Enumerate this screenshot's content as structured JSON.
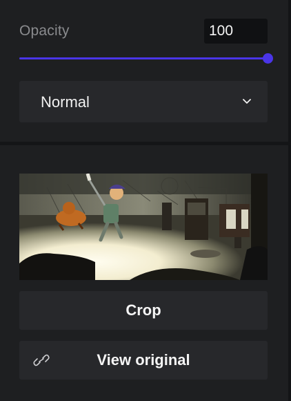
{
  "layer_settings": {
    "opacity_label": "Opacity",
    "opacity_value": "100",
    "opacity_percent": 100,
    "accent_color": "#4a35e8",
    "blend_mode": "Normal"
  },
  "image_panel": {
    "thumbnail_alt": "Illustration of a child raising a sword next to a dog in a sunlit room",
    "crop_label": "Crop",
    "view_original_label": "View original",
    "link_icon": "link-icon"
  }
}
